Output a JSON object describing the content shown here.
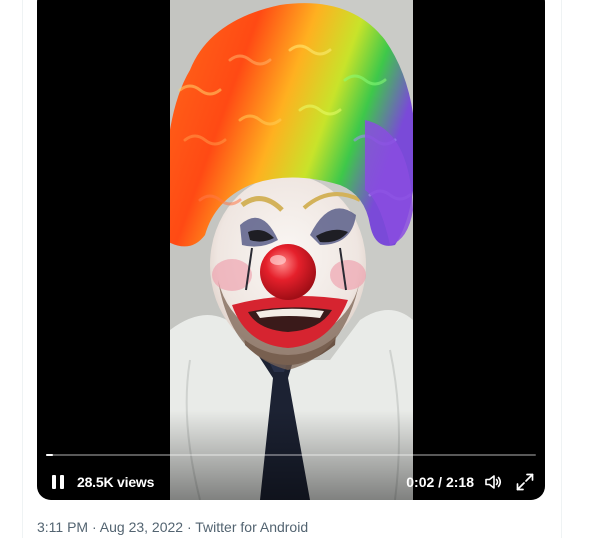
{
  "video": {
    "views": "28.5K views",
    "elapsed": "0:02",
    "duration": "2:18",
    "time_separator": " / ",
    "progress_fraction": 0.0145
  },
  "controls": {
    "pause_icon": "pause-icon",
    "volume_icon": "volume-icon",
    "fullscreen_icon": "fullscreen-icon"
  },
  "tweet_meta": {
    "time": "3:11 PM",
    "separator": " · ",
    "date": "Aug 23, 2022",
    "source": "Twitter for Android"
  },
  "colors": {
    "player_bg": "#000000",
    "meta_text": "#536471",
    "divider": "#eff3f4"
  }
}
